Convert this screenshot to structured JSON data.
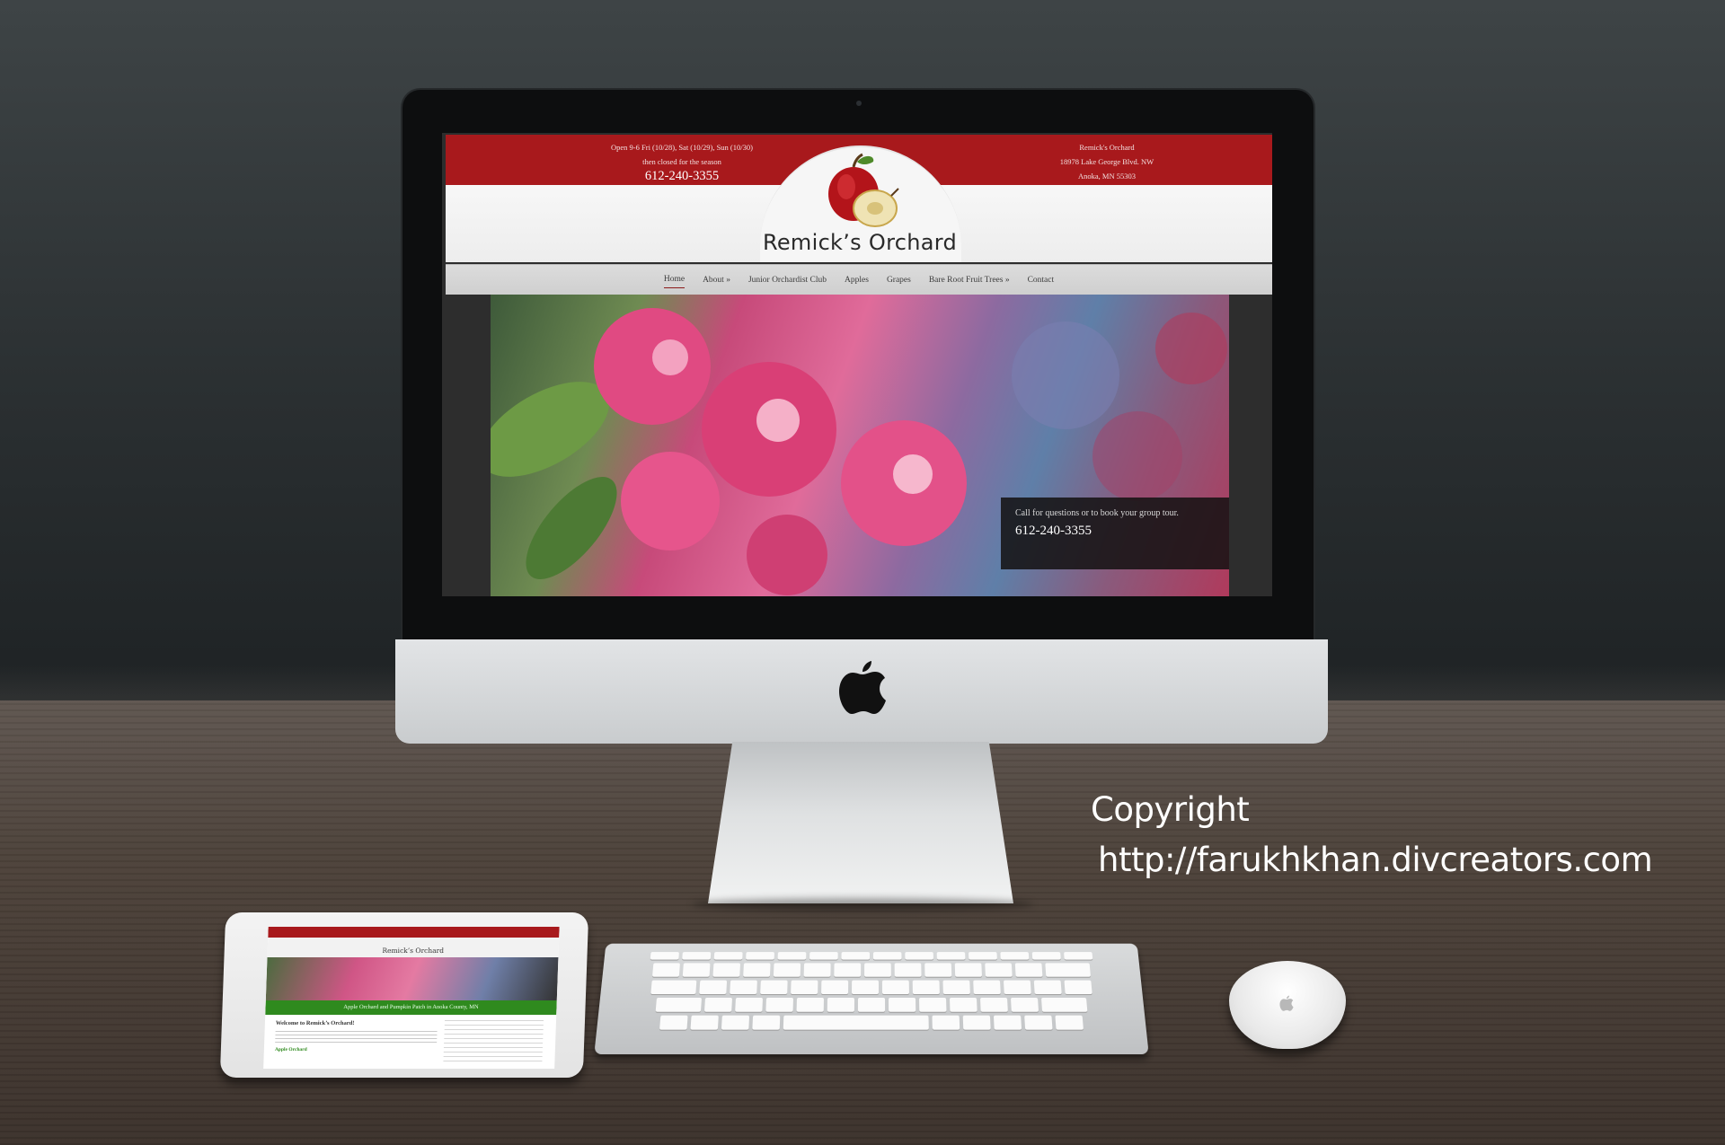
{
  "website": {
    "topbar": {
      "hours_line1": "Open 9-6 Fri (10/28), Sat (10/29), Sun (10/30)",
      "hours_line2": "then closed for the season",
      "phone": "612-240-3355",
      "address_name": "Remick's Orchard",
      "address_street": "18978 Lake George Blvd. NW",
      "address_city": "Anoka, MN 55303"
    },
    "site_title": "Remick’s Orchard",
    "nav": [
      {
        "label": "Home",
        "active": true
      },
      {
        "label": "About »"
      },
      {
        "label": "Junior Orchardist Club"
      },
      {
        "label": "Apples"
      },
      {
        "label": "Grapes"
      },
      {
        "label": "Bare Root Fruit Trees »"
      },
      {
        "label": "Contact"
      }
    ],
    "hero_overlay": {
      "cta": "Call for questions or to book your group tour.",
      "phone": "612-240-3355"
    }
  },
  "tablet": {
    "site_title": "Remick’s Orchard",
    "green_banner": "Apple Orchard and Pumpkin Patch in Anoka County, MN",
    "welcome": "Welcome to Remick’s Orchard!",
    "subheading": "Apple Orchard"
  },
  "watermark": {
    "label": "Copyright",
    "url": "http://farukhkhan.divcreators.com"
  },
  "colors": {
    "brand_red": "#a8191c",
    "nav_bg": "#d6d6d6",
    "tablet_green": "#2f8a1e"
  }
}
